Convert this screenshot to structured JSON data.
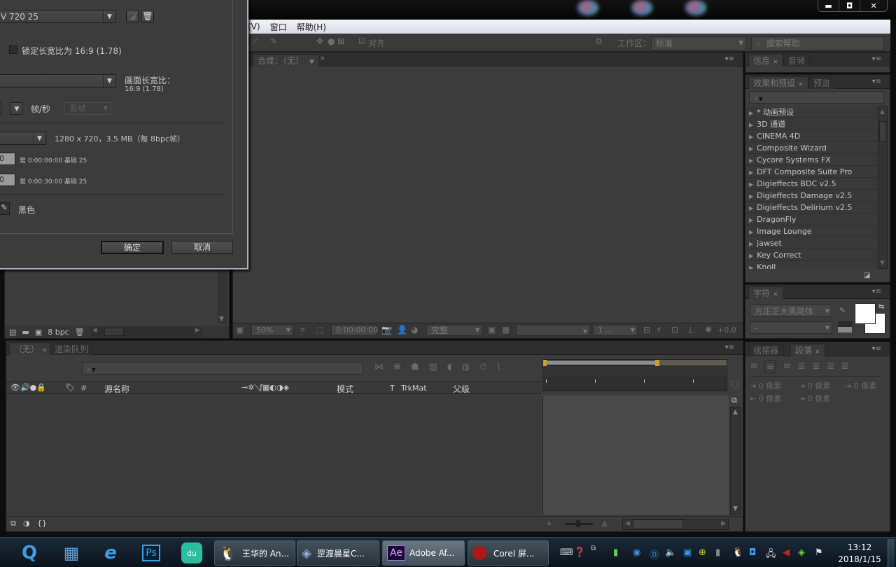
{
  "window": {
    "minimize": "▬",
    "maximize": "◘",
    "close": "✕"
  },
  "menubar": {
    "items": [
      "(V)",
      "窗口",
      "帮助(H)"
    ]
  },
  "toolbar": {
    "snap_label": "对齐",
    "workspace_label": "工作区：",
    "workspace_value": "标准",
    "search_placeholder": "搜索帮助"
  },
  "dialog": {
    "preset_value": "V 720 25",
    "lock_aspect_label": "锁定长宽比为 16:9 (1.78)",
    "frame_aspect_label": "画面长宽比：",
    "frame_aspect_value": "16:9 (1.78)",
    "fps_label": "帧/秒",
    "drop_frame_value": "丢帧",
    "resolution_info": "1280 x 720，3.5 MB（每 8bpc帧）",
    "start_time_field": "0",
    "start_time_info": "是 0:00:00:00  基础 25",
    "duration_field": "0",
    "duration_info": "是 0:00:30:00  基础 25",
    "bg_color_label": "黑色",
    "ok_label": "确定",
    "cancel_label": "取消"
  },
  "project_panel": {
    "bpc_label": "8 bpc"
  },
  "comp_panel": {
    "tab_label": "合成：（无）",
    "zoom_value": "50%",
    "timecode": "0:00:00:00",
    "quality_value": "完整",
    "view_value": "1 ...",
    "exposure_value": "+0.0"
  },
  "info_panel": {
    "tabs": [
      "信息",
      "音频"
    ]
  },
  "effects_panel": {
    "tabs": [
      "效果和预设",
      "预览"
    ],
    "items": [
      "* 动画预设",
      "3D 通道",
      "CINEMA 4D",
      "Composite Wizard",
      "Cycore Systems FX",
      "DFT Composite Suite Pro",
      "Digieffects BDC v2.5",
      "Digieffects Damage v2.5",
      "Digieffects Delirium v2.5",
      "DragonFly",
      "Image Lounge",
      "jawset",
      "Key Correct",
      "Knoll"
    ]
  },
  "character_panel": {
    "tab": "字符",
    "font_value": "方正正大黑简体",
    "style_value": "-"
  },
  "paragraph_panel": {
    "tabs": [
      "摇摆器",
      "段落"
    ],
    "indent_values": [
      "0 像素",
      "0 像素",
      "0 像素",
      "0 像素",
      "0 像素"
    ]
  },
  "timeline": {
    "tabs": [
      "（无）",
      "渲染队列"
    ],
    "columns": {
      "hash": "#",
      "source_name": "源名称",
      "mode": "模式",
      "t": "T",
      "trkmat": "TrkMat",
      "parent": "父级"
    }
  },
  "taskbar": {
    "buttons": [
      {
        "label": "王华的 An..."
      },
      {
        "label": "罡渡晨星C..."
      },
      {
        "label": "Adobe Af..."
      },
      {
        "label": "Corel 屏..."
      }
    ],
    "time": "13:12",
    "date": "2018/1/15"
  }
}
